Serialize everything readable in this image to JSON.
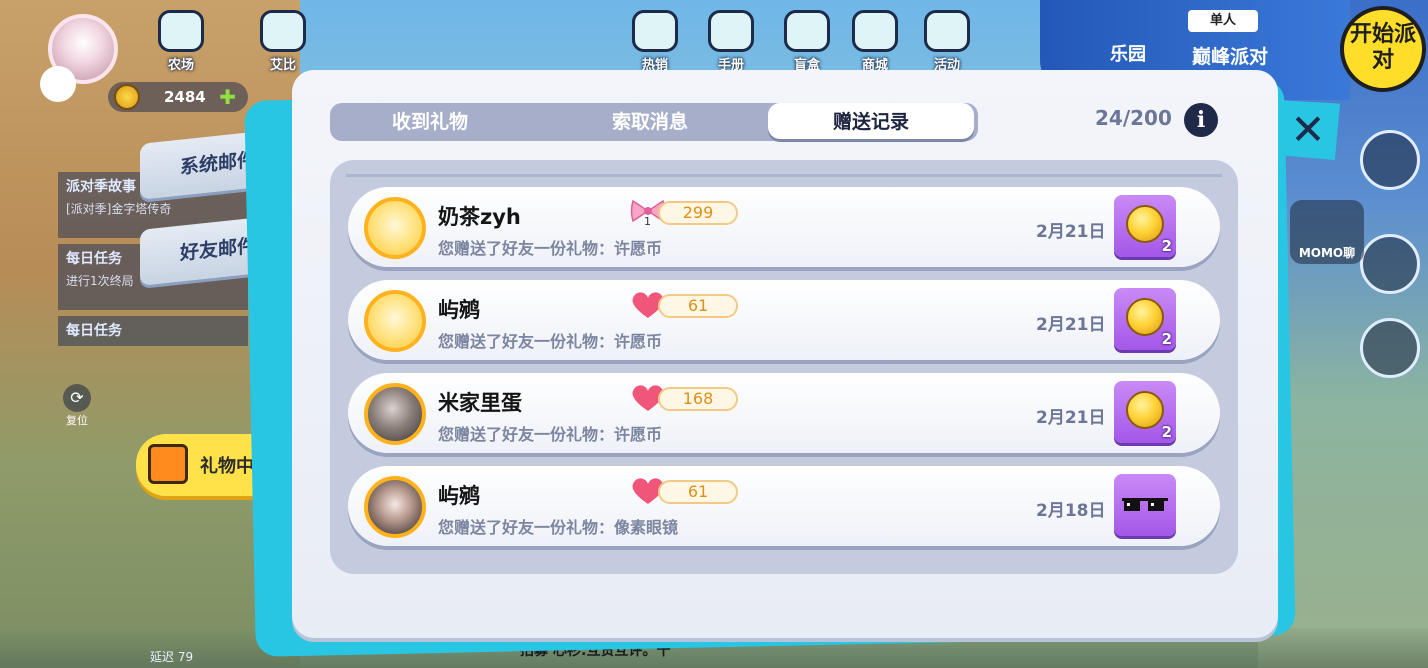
{
  "background": {
    "top_icons": [
      {
        "label": "农场",
        "icon": "farm-icon"
      },
      {
        "label": "艾比",
        "icon": "abby-icon"
      },
      {
        "label": "热销",
        "icon": "hot-sale-icon"
      },
      {
        "label": "手册",
        "icon": "handbook-icon"
      },
      {
        "label": "盲盒",
        "icon": "blind-box-icon"
      },
      {
        "label": "商城",
        "icon": "shop-icon"
      },
      {
        "label": "活动",
        "icon": "event-icon"
      }
    ],
    "currency_value": "2484",
    "mail_tabs": [
      "系统邮件",
      "好友邮件"
    ],
    "tasks": [
      {
        "title": "派对季故事",
        "detail": "[派对季]金字塔传奇"
      },
      {
        "title": "每日任务",
        "detail": "进行1次终局"
      },
      {
        "title": "每日任务",
        "detail": ""
      }
    ],
    "reset_label": "复位",
    "gift_center_label": "礼物中心",
    "right_panel": {
      "park": "乐园",
      "single": "单人",
      "mode": "巅峰派对"
    },
    "start_label": "开始派对",
    "momo_label": "MOMO聊",
    "latency_label": "延迟 79",
    "bottom_chat": "招募  心衫:互赞互评。十"
  },
  "modal": {
    "tabs": [
      {
        "label": "收到礼物",
        "active": false
      },
      {
        "label": "索取消息",
        "active": false
      },
      {
        "label": "赠送记录",
        "active": true
      }
    ],
    "count": "24/200",
    "info_icon": "info-icon",
    "close_icon": "close-icon",
    "records": [
      {
        "name": "奶茶zyh",
        "desc": "您赠送了好友一份礼物：许愿币",
        "badge_icon": "bow-icon",
        "badge_value": "1",
        "points": "299",
        "date": "2月21日",
        "item": "wish-coin-icon",
        "qty": "2",
        "avatar": "plain"
      },
      {
        "name": "屿鹓",
        "desc": "您赠送了好友一份礼物：许愿币",
        "badge_icon": "heart-icon",
        "points": "61",
        "date": "2月21日",
        "item": "wish-coin-icon",
        "qty": "2",
        "avatar": "plain"
      },
      {
        "name": "米家里蛋",
        "desc": "您赠送了好友一份礼物：许愿币",
        "badge_icon": "heart-icon",
        "points": "168",
        "date": "2月21日",
        "item": "wish-coin-icon",
        "qty": "2",
        "avatar": "photo1"
      },
      {
        "name": "屿鹓",
        "desc": "您赠送了好友一份礼物：像素眼镜",
        "badge_icon": "heart-icon",
        "points": "61",
        "date": "2月18日",
        "item": "pixel-glasses-icon",
        "qty": "",
        "avatar": "photo2"
      }
    ]
  },
  "colors": {
    "accent_cyan": "#29c6e4",
    "item_purple": "#a457e8",
    "points_orange": "#e08f16",
    "heart_pink": "#f0557a"
  }
}
